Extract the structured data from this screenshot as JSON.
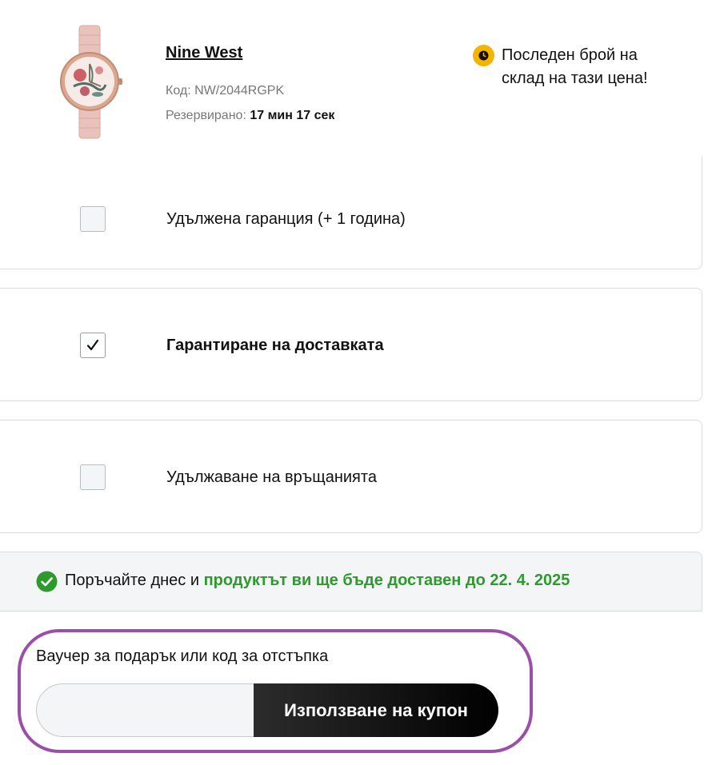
{
  "product": {
    "name": "Nine West",
    "code_label": "Код:",
    "code_value": "NW/2044RGPK",
    "reserved_label": "Резервирано:",
    "reserved_timer": "17 мин 17 сек",
    "image_icon": "rose-gold-watch-image"
  },
  "stock_notice": {
    "icon": "clock-icon",
    "line1": "Последен брой на",
    "line2": "склад на тази цена!",
    "icon_color": "#f5b400"
  },
  "options": [
    {
      "label": "Удължена гаранция (+ 1 година)",
      "checked": false
    },
    {
      "label": "Гарантиране на доставката",
      "checked": true
    },
    {
      "label": "Удължаване на връщанията",
      "checked": false
    }
  ],
  "delivery": {
    "icon": "check-circle-icon",
    "prefix": "Поръчайте днес и",
    "highlight": "продуктът ви ще бъде доставен до 22. 4. 2025",
    "highlight_color": "#2e9a2e"
  },
  "voucher": {
    "label": "Ваучер за подарък или код за отстъпка",
    "input_value": "",
    "button_label": "Използване на купон",
    "highlight_color": "#9b4fa8"
  }
}
